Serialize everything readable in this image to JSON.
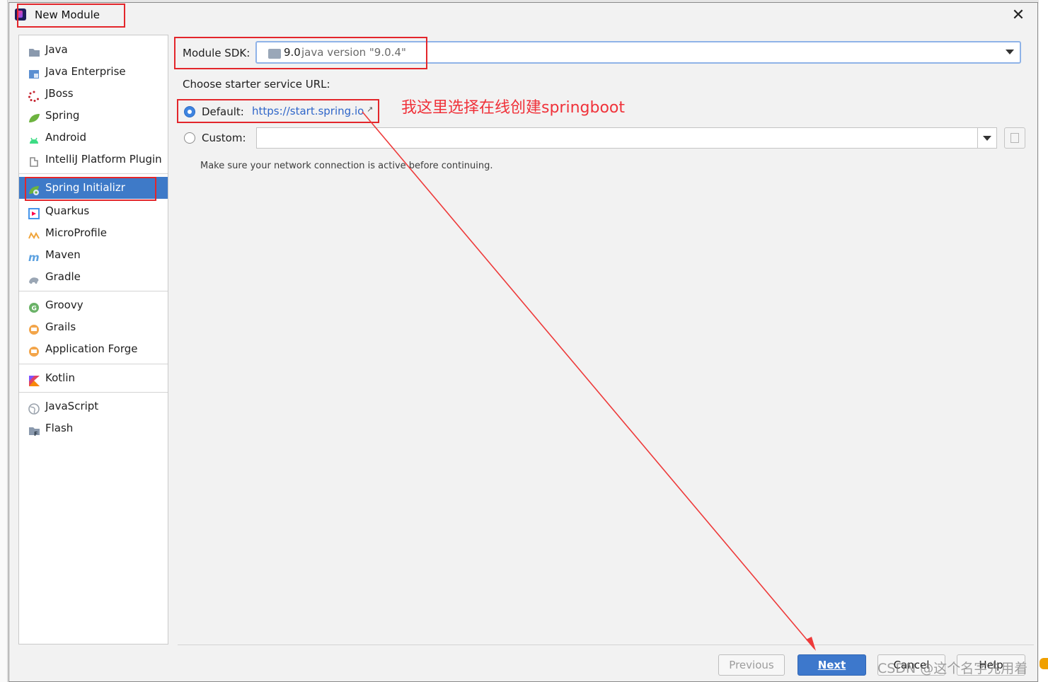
{
  "window": {
    "title": "New Module",
    "close_glyph": "✕"
  },
  "project_types": [
    {
      "label": "Java",
      "icon": "folder-icon",
      "color": "#8a99ad"
    },
    {
      "label": "Java Enterprise",
      "icon": "java-enterprise-icon",
      "color": "#5b8fd1"
    },
    {
      "label": "JBoss",
      "icon": "jboss-icon",
      "color": "#c4202c"
    },
    {
      "label": "Spring",
      "icon": "spring-leaf-icon",
      "color": "#6db33f"
    },
    {
      "label": "Android",
      "icon": "android-icon",
      "color": "#3ddc84"
    },
    {
      "label": "IntelliJ Platform Plugin",
      "icon": "plugin-icon",
      "color": "#8a8a8a"
    },
    {
      "label": "Spring Initializr",
      "icon": "spring-initializr-icon",
      "color": "#6db33f",
      "selected": true
    },
    {
      "label": "Quarkus",
      "icon": "quarkus-icon",
      "color": "#4695eb"
    },
    {
      "label": "MicroProfile",
      "icon": "microprofile-icon",
      "color": "#f0a43a"
    },
    {
      "label": "Maven",
      "icon": "maven-icon",
      "color": "#5ca1e0"
    },
    {
      "label": "Gradle",
      "icon": "gradle-icon",
      "color": "#9aa6b4"
    },
    {
      "label": "Groovy",
      "icon": "groovy-icon",
      "color": "#6ab267"
    },
    {
      "label": "Grails",
      "icon": "grails-icon",
      "color": "#f3a54a"
    },
    {
      "label": "Application Forge",
      "icon": "forge-icon",
      "color": "#f3a54a"
    },
    {
      "label": "Kotlin",
      "icon": "kotlin-icon",
      "color": "#e24462"
    },
    {
      "label": "JavaScript",
      "icon": "globe-icon",
      "color": "#9aa2ac"
    },
    {
      "label": "Flash",
      "icon": "flash-folder-icon",
      "color": "#8a99ad"
    }
  ],
  "sdk": {
    "label": "Module SDK:",
    "version": "9.0",
    "description": "java version \"9.0.4\""
  },
  "starter": {
    "label": "Choose starter service URL:",
    "default_label": "Default:",
    "default_url": "https://start.spring.io",
    "external_glyph": "↗",
    "custom_label": "Custom:",
    "custom_value": "",
    "hint": "Make sure your network connection is active before continuing."
  },
  "annotation": {
    "text": "我这里选择在线创建springboot",
    "color": "#f0323a"
  },
  "buttons": {
    "previous": "Previous",
    "next": "Next",
    "cancel": "Cancel",
    "help": "Help"
  },
  "watermark": "CSDN @这个名字先用着"
}
